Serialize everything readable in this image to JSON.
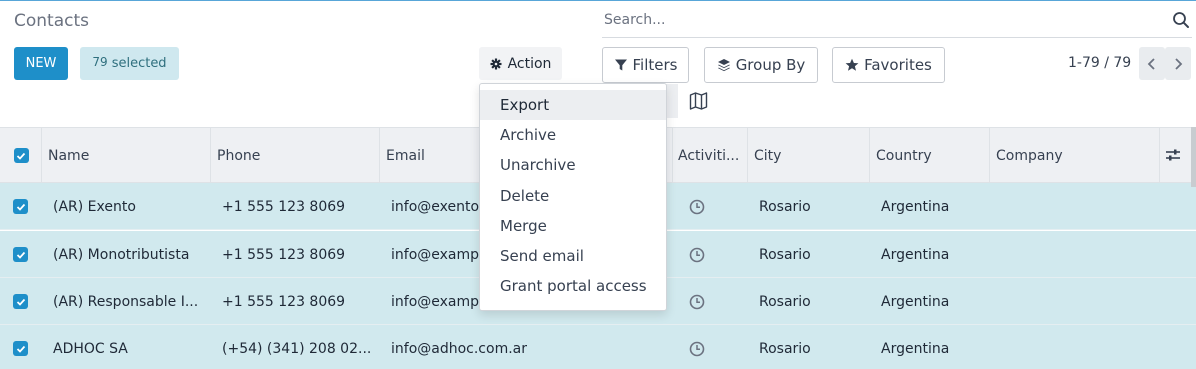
{
  "header": {
    "title": "Contacts",
    "search_placeholder": "Search..."
  },
  "toolbar": {
    "new_label": "NEW",
    "selected_count": "79",
    "selected_label": "selected",
    "action_label": "Action",
    "filters_label": "Filters",
    "group_by_label": "Group By",
    "favorites_label": "Favorites",
    "pager_text": "1-79 / 79"
  },
  "action_menu": {
    "items": [
      "Export",
      "Archive",
      "Unarchive",
      "Delete",
      "Merge",
      "Send email",
      "Grant portal access"
    ],
    "highlighted": "Export"
  },
  "table": {
    "columns": [
      "Name",
      "Phone",
      "Email",
      "Activiti...",
      "City",
      "Country",
      "Company"
    ],
    "rows": [
      {
        "name": "(AR) Exento",
        "phone": "+1 555 123 8069",
        "email": "info@exento.",
        "city": "Rosario",
        "country": "Argentina",
        "company": ""
      },
      {
        "name": "(AR) Monotributista",
        "phone": "+1 555 123 8069",
        "email": "info@exampl",
        "city": "Rosario",
        "country": "Argentina",
        "company": ""
      },
      {
        "name": "(AR) Responsable I...",
        "phone": "+1 555 123 8069",
        "email": "info@exampl",
        "city": "Rosario",
        "country": "Argentina",
        "company": ""
      },
      {
        "name": "ADHOC SA",
        "phone": "(+54) (341) 208 02...",
        "email": "info@adhoc.com.ar",
        "city": "Rosario",
        "country": "Argentina",
        "company": ""
      }
    ]
  },
  "colors": {
    "primary": "#1e8fc9",
    "selected_row": "#d1e9ee",
    "header_bg": "#eef0f3"
  }
}
